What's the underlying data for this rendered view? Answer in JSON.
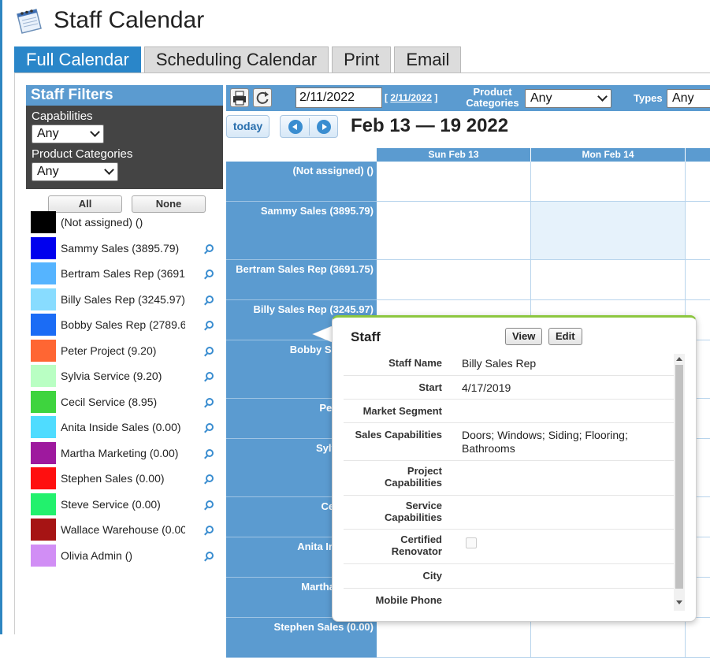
{
  "page": {
    "title": "Staff Calendar"
  },
  "tabs": [
    {
      "label": "Full Calendar",
      "active": true
    },
    {
      "label": "Scheduling Calendar",
      "active": false
    },
    {
      "label": "Print",
      "active": false
    },
    {
      "label": "Email",
      "active": false
    }
  ],
  "filters": {
    "title": "Staff Filters",
    "capabilities_label": "Capabilities",
    "capabilities_value": "Any",
    "product_categories_label": "Product Categories",
    "product_categories_value": "Any",
    "all_label": "All",
    "none_label": "None"
  },
  "staff": [
    {
      "name": "(Not assigned) ()",
      "color": "#000000",
      "zoom": false
    },
    {
      "name": "Sammy Sales (3895.79)",
      "color": "#0000ee",
      "zoom": true
    },
    {
      "name": "Bertram Sales Rep (3691",
      "color": "#55b4ff",
      "zoom": true
    },
    {
      "name": "Billy Sales Rep (3245.97)",
      "color": "#88dcff",
      "zoom": true
    },
    {
      "name": "Bobby Sales Rep (2789.6",
      "color": "#1b6cf5",
      "zoom": true
    },
    {
      "name": "Peter Project (9.20)",
      "color": "#ff6633",
      "zoom": true
    },
    {
      "name": "Sylvia Service (9.20)",
      "color": "#b9ffc3",
      "zoom": true
    },
    {
      "name": "Cecil Service (8.95)",
      "color": "#3ed43e",
      "zoom": true
    },
    {
      "name": "Anita Inside Sales (0.00)",
      "color": "#4fdcff",
      "zoom": true
    },
    {
      "name": "Martha Marketing (0.00)",
      "color": "#9e199e",
      "zoom": true
    },
    {
      "name": "Stephen Sales (0.00)",
      "color": "#ff0f0f",
      "zoom": true
    },
    {
      "name": "Steve Service (0.00)",
      "color": "#22f16d",
      "zoom": true
    },
    {
      "name": "Wallace Warehouse (0.00",
      "color": "#a61414",
      "zoom": true
    },
    {
      "name": "Olivia Admin ()",
      "color": "#d18ef5",
      "zoom": true
    }
  ],
  "toolbar": {
    "date_value": "2/11/2022",
    "date_link_open": "[ ",
    "date_link": "2/11/2022",
    "date_link_close": " ]",
    "product_categories_label": "Product Categories",
    "product_categories_value": "Any",
    "types_label": "Types",
    "types_value": "Any",
    "print_icon": "printer-icon",
    "refresh_icon": "refresh-icon"
  },
  "nav": {
    "today_label": "today",
    "range_label": "Feb 13 — 19 2022"
  },
  "calendar": {
    "days": [
      "Sun Feb 13",
      "Mon Feb 14"
    ],
    "rows": [
      {
        "label": "(Not assigned) ()"
      },
      {
        "label": "Sammy Sales (3895.79)"
      },
      {
        "label": "Bertram Sales Rep (3691.75)"
      },
      {
        "label": "Billy Sales Rep (3245.97)"
      },
      {
        "label": "Bobby Sales Rep"
      },
      {
        "label": "Peter Proje"
      },
      {
        "label": "Sylvia Servi"
      },
      {
        "label": "Cecil Servi"
      },
      {
        "label": "Anita Inside Sal"
      },
      {
        "label": "Martha Marketi"
      },
      {
        "label": "Stephen Sales (0.00)"
      }
    ]
  },
  "popover": {
    "title": "Staff",
    "view_label": "View",
    "edit_label": "Edit",
    "fields": [
      {
        "label": "Staff Name",
        "value": "Billy Sales Rep"
      },
      {
        "label": "Start",
        "value": "4/17/2019"
      },
      {
        "label": "Market Segment",
        "value": ""
      },
      {
        "label": "Sales Capabilities",
        "value": "Doors; Windows; Siding; Flooring; Bathrooms"
      },
      {
        "label": "Project Capabilities",
        "value": ""
      },
      {
        "label": "Service Capabilities",
        "value": ""
      },
      {
        "label": "Certified Renovator",
        "value": "",
        "checkbox": true
      },
      {
        "label": "City",
        "value": ""
      },
      {
        "label": "Mobile Phone",
        "value": ""
      }
    ]
  }
}
